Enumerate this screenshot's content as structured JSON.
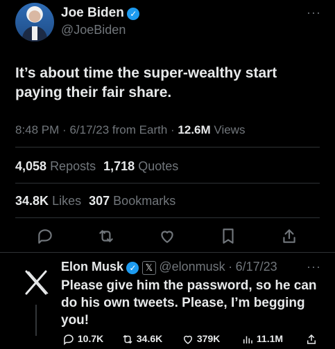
{
  "tweet": {
    "author_name": "Joe Biden",
    "author_handle": "@JoeBiden",
    "text": "It’s about time the super-wealthy start paying their fair share.",
    "time": "8:48 PM",
    "date": "6/17/23",
    "source": "from Earth",
    "views_count": "12.6M",
    "views_label": "Views",
    "reposts_count": "4,058",
    "reposts_label": "Reposts",
    "quotes_count": "1,718",
    "quotes_label": "Quotes",
    "likes_count": "34.8K",
    "likes_label": "Likes",
    "bookmarks_count": "307",
    "bookmarks_label": "Bookmarks",
    "more_icon": "more-dots-icon"
  },
  "reply": {
    "author_name": "Elon Musk",
    "author_handle": "@elonmusk",
    "date": "6/17/23",
    "text": "Please give him the password, so he can do his own tweets. Please, I’m begging you!",
    "replies": "10.7K",
    "reposts": "34.6K",
    "likes": "379K",
    "views": "11.1M"
  },
  "colors": {
    "background": "#000000",
    "text": "#e7e9ea",
    "muted": "#71767b",
    "accent": "#1d9bf0",
    "divider": "#2f3336"
  }
}
